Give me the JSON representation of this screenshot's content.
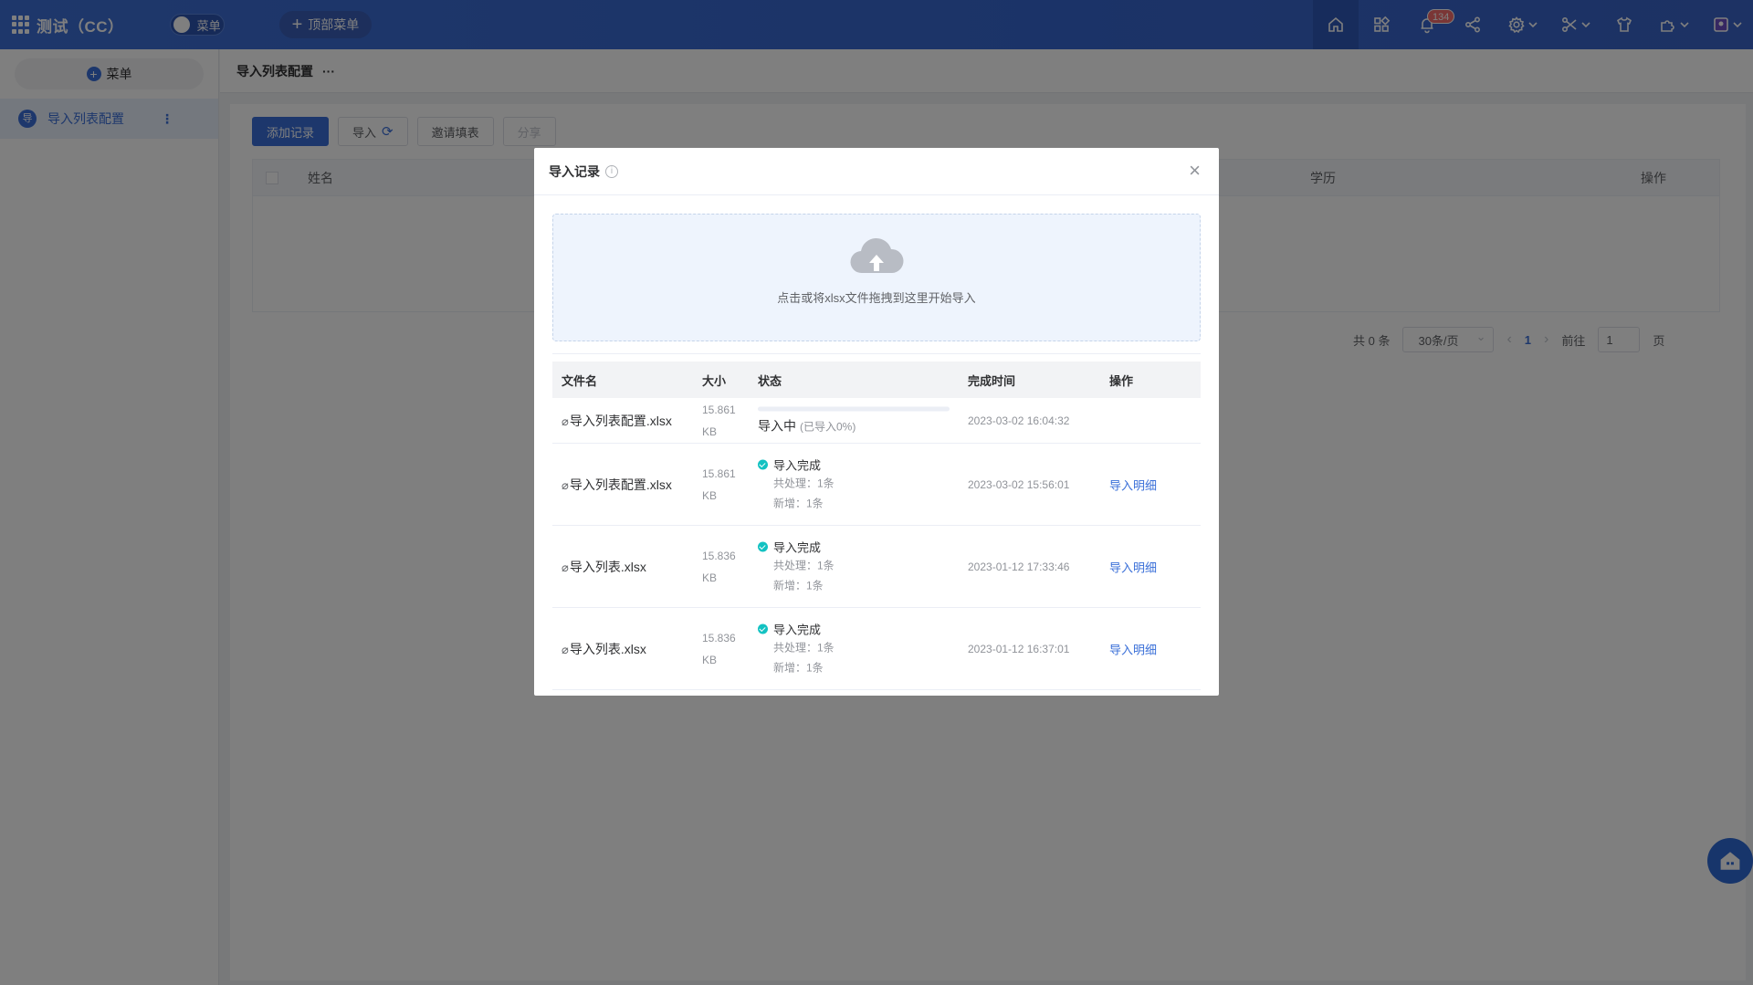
{
  "topbar": {
    "app_title": "测试（CC）",
    "menu_toggle_label": "菜单",
    "top_menu_label": "顶部菜单",
    "notification_count": "134"
  },
  "sidebar": {
    "menu_button_label": "菜单",
    "items": [
      {
        "icon_char": "导",
        "label": "导入列表配置"
      }
    ]
  },
  "main": {
    "page_title": "导入列表配置",
    "toolbar": {
      "add_label": "添加记录",
      "import_label": "导入",
      "invite_label": "邀请填表",
      "share_label": "分享"
    },
    "table": {
      "columns": [
        "姓名",
        "学历",
        "操作"
      ]
    },
    "pager": {
      "total": "共 0 条",
      "page_size": "30条/页",
      "current_page": "1",
      "goto_label": "前往",
      "goto_value": "1",
      "page_unit": "页"
    }
  },
  "modal": {
    "title": "导入记录",
    "close_symbol": "×",
    "upload_hint": "点击或将xlsx文件拖拽到这里开始导入",
    "columns": {
      "name": "文件名",
      "size": "大小",
      "status": "状态",
      "time": "完成时间",
      "op": "操作"
    },
    "rows": [
      {
        "file": "导入列表配置.xlsx",
        "size": "15.861 KB",
        "status": "导入中",
        "progress_text": "(已导入0%)",
        "progress": 0,
        "time": "2023-03-02 16:04:32",
        "op": ""
      },
      {
        "file": "导入列表配置.xlsx",
        "size": "15.861 KB",
        "status": "导入完成",
        "processed": "共处理：1条",
        "added": "新增：1条",
        "time": "2023-03-02 15:56:01",
        "op": "导入明细"
      },
      {
        "file": "导入列表.xlsx",
        "size": "15.836 KB",
        "status": "导入完成",
        "processed": "共处理：1条",
        "added": "新增：1条",
        "time": "2023-01-12 17:33:46",
        "op": "导入明细"
      },
      {
        "file": "导入列表.xlsx",
        "size": "15.836 KB",
        "status": "导入完成",
        "processed": "共处理：1条",
        "added": "新增：1条",
        "time": "2023-01-12 16:37:01",
        "op": "导入明细"
      }
    ]
  },
  "colors": {
    "primary": "#3a6fd8",
    "topbar": "#3767d0",
    "success": "#13c2c2"
  }
}
